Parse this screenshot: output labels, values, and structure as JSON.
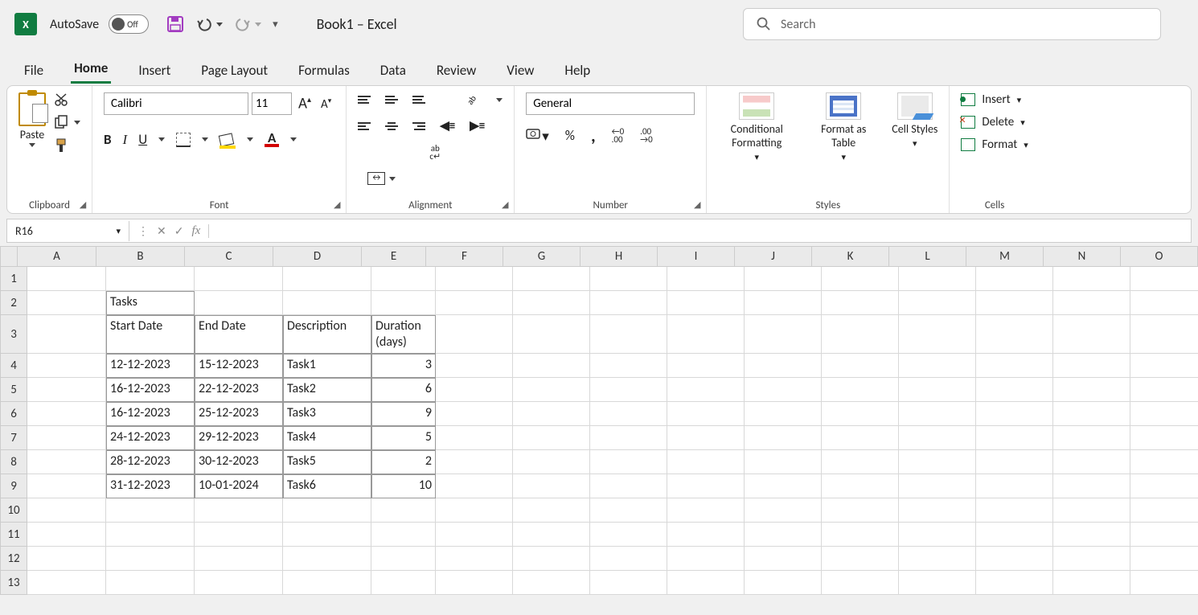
{
  "title": {
    "autosave_label": "AutoSave",
    "autosave_state": "Off",
    "doc": "Book1  –  Excel"
  },
  "search": {
    "placeholder": "Search"
  },
  "tabs": [
    "File",
    "Home",
    "Insert",
    "Page Layout",
    "Formulas",
    "Data",
    "Review",
    "View",
    "Help"
  ],
  "active_tab": "Home",
  "ribbon": {
    "clipboard": {
      "paste": "Paste",
      "label": "Clipboard"
    },
    "font": {
      "name": "Calibri",
      "size": "11",
      "bold": "B",
      "italic": "I",
      "underline": "U",
      "grow": "A",
      "shrink": "A",
      "label": "Font",
      "color_letter": "A"
    },
    "alignment": {
      "label": "Alignment"
    },
    "number": {
      "format": "General",
      "label": "Number",
      "percent": "%",
      "comma": ",",
      "inc": "←0\n.00",
      "dec": ".00\n→0"
    },
    "styles": {
      "cond": "Conditional Formatting",
      "table": "Format as Table",
      "cell": "Cell Styles",
      "label": "Styles"
    },
    "cells": {
      "insert": "Insert",
      "delete": "Delete",
      "format": "Format",
      "label": "Cells"
    }
  },
  "formula_bar": {
    "name_box": "R16",
    "value": ""
  },
  "columns": [
    "A",
    "B",
    "C",
    "D",
    "E",
    "F",
    "G",
    "H",
    "I",
    "J",
    "K",
    "L",
    "M",
    "N",
    "O"
  ],
  "row_count": 13,
  "sheet": {
    "B2": "Tasks",
    "B3": "Start Date",
    "C3": "End Date",
    "D3": "Description",
    "E3": "Duration (days)",
    "rows": [
      {
        "B": "12-12-2023",
        "C": "15-12-2023",
        "D": "Task1",
        "E": "3"
      },
      {
        "B": "16-12-2023",
        "C": "22-12-2023",
        "D": "Task2",
        "E": "6"
      },
      {
        "B": "16-12-2023",
        "C": "25-12-2023",
        "D": "Task3",
        "E": "9"
      },
      {
        "B": "24-12-2023",
        "C": "29-12-2023",
        "D": "Task4",
        "E": "5"
      },
      {
        "B": "28-12-2023",
        "C": "30-12-2023",
        "D": "Task5",
        "E": "2"
      },
      {
        "B": "31-12-2023",
        "C": "10-01-2024",
        "D": "Task6",
        "E": "10"
      }
    ]
  }
}
